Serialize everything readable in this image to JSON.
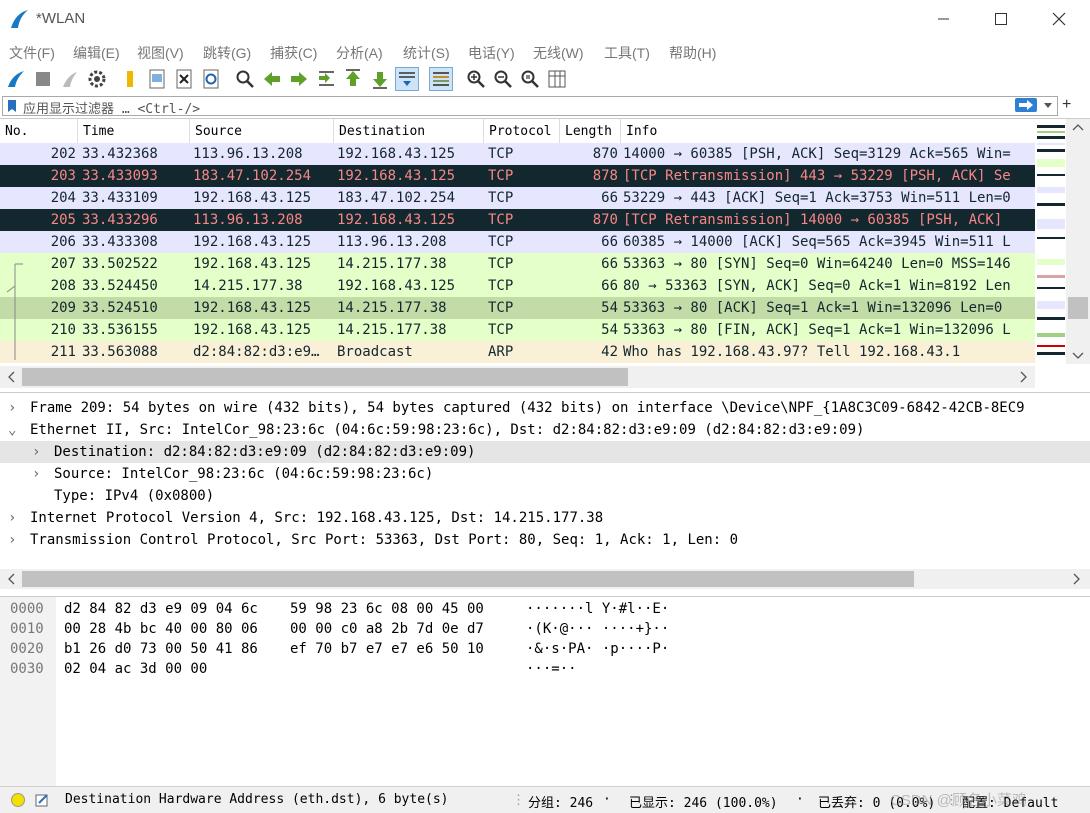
{
  "window": {
    "title": "*WLAN"
  },
  "menu": [
    "文件(F)",
    "编辑(E)",
    "视图(V)",
    "跳转(G)",
    "捕获(C)",
    "分析(A)",
    "统计(S)",
    "电话(Y)",
    "无线(W)",
    "工具(T)",
    "帮助(H)"
  ],
  "filter": {
    "placeholder": "应用显示过滤器 … <Ctrl-/>"
  },
  "packet_list": {
    "columns": [
      "No.",
      "Time",
      "Source",
      "Destination",
      "Protocol",
      "Length",
      "Info"
    ],
    "rows": [
      {
        "no": "202",
        "time": "33.432368",
        "src": "113.96.13.208",
        "dst": "192.168.43.125",
        "proto": "TCP",
        "len": "870",
        "info": "14000 → 60385 [PSH, ACK] Seq=3129 Ack=565 Win=",
        "bg": "#e7e6ff",
        "fg": "#12272e"
      },
      {
        "no": "203",
        "time": "33.433093",
        "src": "183.47.102.254",
        "dst": "192.168.43.125",
        "proto": "TCP",
        "len": "878",
        "info": "[TCP Retransmission] 443 → 53229 [PSH, ACK] Se",
        "bg": "#12272e",
        "fg": "#f78787"
      },
      {
        "no": "204",
        "time": "33.433109",
        "src": "192.168.43.125",
        "dst": "183.47.102.254",
        "proto": "TCP",
        "len": "66",
        "info": "53229 → 443 [ACK] Seq=1 Ack=3753 Win=511 Len=0",
        "bg": "#e7e6ff",
        "fg": "#12272e"
      },
      {
        "no": "205",
        "time": "33.433296",
        "src": "113.96.13.208",
        "dst": "192.168.43.125",
        "proto": "TCP",
        "len": "870",
        "info": "[TCP Retransmission] 14000 → 60385 [PSH, ACK]",
        "bg": "#12272e",
        "fg": "#f78787"
      },
      {
        "no": "206",
        "time": "33.433308",
        "src": "192.168.43.125",
        "dst": "113.96.13.208",
        "proto": "TCP",
        "len": "66",
        "info": "60385 → 14000 [ACK] Seq=565 Ack=3945 Win=511 L",
        "bg": "#e7e6ff",
        "fg": "#12272e"
      },
      {
        "no": "207",
        "time": "33.502522",
        "src": "192.168.43.125",
        "dst": "14.215.177.38",
        "proto": "TCP",
        "len": "66",
        "info": "53363 → 80 [SYN] Seq=0 Win=64240 Len=0 MSS=146",
        "bg": "#e4ffc7",
        "fg": "#12272e"
      },
      {
        "no": "208",
        "time": "33.524450",
        "src": "14.215.177.38",
        "dst": "192.168.43.125",
        "proto": "TCP",
        "len": "66",
        "info": "80 → 53363 [SYN, ACK] Seq=0 Ack=1 Win=8192 Len",
        "bg": "#e4ffc7",
        "fg": "#12272e"
      },
      {
        "no": "209",
        "time": "33.524510",
        "src": "192.168.43.125",
        "dst": "14.215.177.38",
        "proto": "TCP",
        "len": "54",
        "info": "53363 → 80 [ACK] Seq=1 Ack=1 Win=132096 Len=0",
        "bg": "#c3dba6",
        "fg": "#12272e"
      },
      {
        "no": "210",
        "time": "33.536155",
        "src": "192.168.43.125",
        "dst": "14.215.177.38",
        "proto": "TCP",
        "len": "54",
        "info": "53363 → 80 [FIN, ACK] Seq=1 Ack=1 Win=132096 L",
        "bg": "#e4ffc7",
        "fg": "#12272e"
      },
      {
        "no": "211",
        "time": "33.563088",
        "src": "d2:84:82:d3:e9…",
        "dst": "Broadcast",
        "proto": "ARP",
        "len": "42",
        "info": "Who has 192.168.43.97? Tell 192.168.43.1",
        "bg": "#faf0d7",
        "fg": "#12272e"
      }
    ]
  },
  "details": [
    {
      "text": "Frame 209: 54 bytes on wire (432 bits), 54 bytes captured (432 bits) on interface \\Device\\NPF_{1A8C3C09-6842-42CB-8EC9",
      "arrow": "›",
      "indent": 0,
      "selected": false
    },
    {
      "text": "Ethernet II, Src: IntelCor_98:23:6c (04:6c:59:98:23:6c), Dst: d2:84:82:d3:e9:09 (d2:84:82:d3:e9:09)",
      "arrow": "⌄",
      "indent": 0,
      "selected": false
    },
    {
      "text": "Destination: d2:84:82:d3:e9:09 (d2:84:82:d3:e9:09)",
      "arrow": "›",
      "indent": 1,
      "selected": true
    },
    {
      "text": "Source: IntelCor_98:23:6c (04:6c:59:98:23:6c)",
      "arrow": "›",
      "indent": 1,
      "selected": false
    },
    {
      "text": "Type: IPv4 (0x0800)",
      "arrow": "",
      "indent": 1,
      "selected": false
    },
    {
      "text": "Internet Protocol Version 4, Src: 192.168.43.125, Dst: 14.215.177.38",
      "arrow": "›",
      "indent": 0,
      "selected": false
    },
    {
      "text": "Transmission Control Protocol, Src Port: 53363, Dst Port: 80, Seq: 1, Ack: 1, Len: 0",
      "arrow": "›",
      "indent": 0,
      "selected": false
    }
  ],
  "bytes": [
    {
      "offset": "0000",
      "hex1": "d2 84 82 d3 e9 09 04 6c",
      "hex2": "59 98 23 6c 08 00 45 00",
      "ascii": "·······l Y·#l··E·"
    },
    {
      "offset": "0010",
      "hex1": "00 28 4b bc 40 00 80 06",
      "hex2": "00 00 c0 a8 2b 7d 0e d7",
      "ascii": "·(K·@··· ····+}··"
    },
    {
      "offset": "0020",
      "hex1": "b1 26 d0 73 00 50 41 86",
      "hex2": "ef 70 b7 e7 e7 e6 50 10",
      "ascii": "·&·s·PA· ·p····P·"
    },
    {
      "offset": "0030",
      "hex1": "02 04 ac 3d 00 00",
      "hex2": "",
      "ascii": "···=··"
    }
  ],
  "status": {
    "field": "Destination Hardware Address (eth.dst), 6 byte(s)",
    "packets": "分组: 246",
    "displayed": "已显示: 246 (100.0%)",
    "dropped": "已丢弃: 0 (0.0%)",
    "profile": "配置: Default",
    "watermark": "CSDN @顾名小菜鸡"
  }
}
